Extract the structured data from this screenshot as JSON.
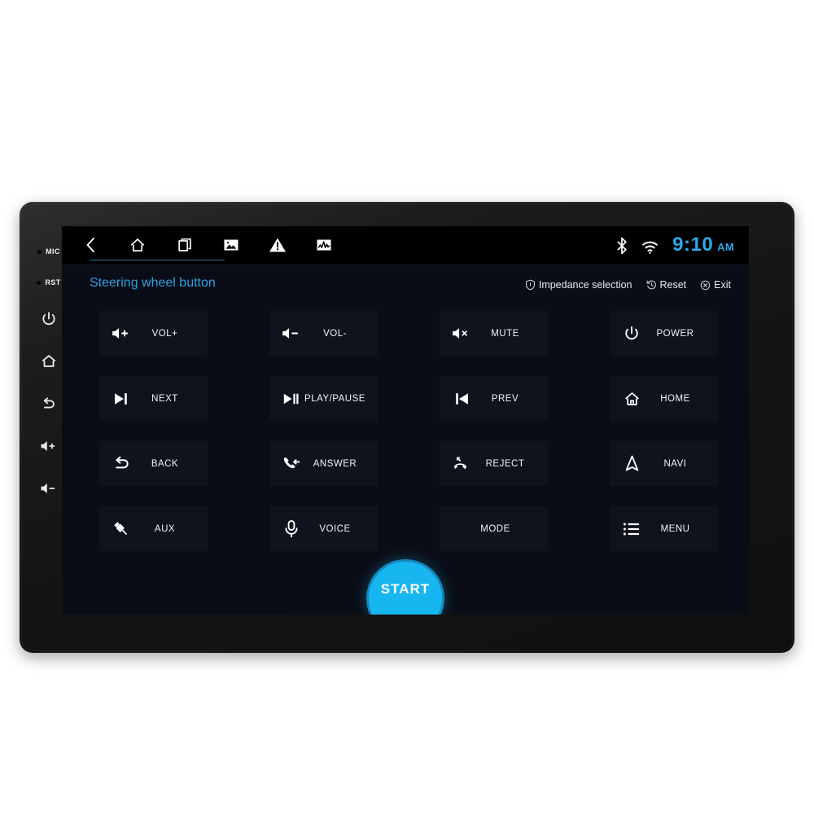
{
  "statusbar": {
    "nav_icons": [
      {
        "name": "back-icon",
        "label": "Back"
      },
      {
        "name": "home-icon",
        "label": "Home"
      },
      {
        "name": "recents-icon",
        "label": "Recent apps"
      },
      {
        "name": "gallery-icon",
        "label": "Gallery"
      },
      {
        "name": "warning-icon",
        "label": "Warning"
      },
      {
        "name": "equalizer-icon",
        "label": "Equalizer"
      }
    ],
    "bluetooth_icon": "bluetooth-icon",
    "wifi_icon": "wifi-icon",
    "time": "9:10",
    "ampm": "AM"
  },
  "header": {
    "tab_title": "Steering wheel button",
    "actions": [
      {
        "icon": "shield-icon",
        "label": "Impedance selection"
      },
      {
        "icon": "history-icon",
        "label": "Reset"
      },
      {
        "icon": "close-circle-icon",
        "label": "Exit"
      }
    ]
  },
  "grid": {
    "buttons": [
      {
        "icon": "volume-up-icon",
        "label": "VOL+"
      },
      {
        "icon": "volume-down-icon",
        "label": "VOL-"
      },
      {
        "icon": "volume-mute-icon",
        "label": "MUTE"
      },
      {
        "icon": "power-icon",
        "label": "POWER"
      },
      {
        "icon": "next-track-icon",
        "label": "NEXT"
      },
      {
        "icon": "play-pause-icon",
        "label": "PLAY/PAUSE"
      },
      {
        "icon": "prev-track-icon",
        "label": "PREV"
      },
      {
        "icon": "home-outline-icon",
        "label": "HOME"
      },
      {
        "icon": "back-arrow-icon",
        "label": "BACK"
      },
      {
        "icon": "phone-answer-icon",
        "label": "ANSWER"
      },
      {
        "icon": "phone-reject-icon",
        "label": "REJECT"
      },
      {
        "icon": "navigation-icon",
        "label": "NAVI"
      },
      {
        "icon": "aux-plug-icon",
        "label": "AUX"
      },
      {
        "icon": "microphone-icon",
        "label": "VOICE"
      },
      {
        "icon": "",
        "label": "MODE"
      },
      {
        "icon": "list-menu-icon",
        "label": "MENU"
      }
    ],
    "start_label": "START"
  },
  "bezel": {
    "keys": [
      {
        "name": "mic-pinhole",
        "label": "MIC"
      },
      {
        "name": "reset-pinhole",
        "label": "RST"
      },
      {
        "name": "power-key",
        "label": ""
      },
      {
        "name": "home-key",
        "label": ""
      },
      {
        "name": "back-key",
        "label": ""
      },
      {
        "name": "volume-up-key",
        "label": ""
      },
      {
        "name": "volume-down-key",
        "label": ""
      }
    ]
  },
  "colors": {
    "accent": "#29a9e8",
    "tab_accent": "#2f9fe0",
    "screen_bg": "#0a0d16",
    "button_bg": "#10131d",
    "start_bg": "#18b6f0"
  }
}
